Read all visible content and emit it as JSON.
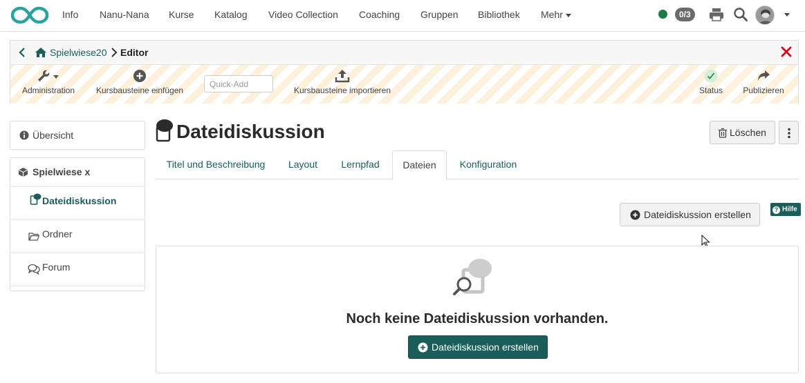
{
  "nav": {
    "items": [
      "Info",
      "Nanu-Nana",
      "Kurse",
      "Katalog",
      "Video Collection",
      "Coaching",
      "Gruppen",
      "Bibliothek"
    ],
    "more_label": "Mehr",
    "score": "0/3",
    "status_color": "#1e7a4a"
  },
  "breadcrumb": {
    "course": "Spielwiese20",
    "current": "Editor"
  },
  "toolbar": {
    "administration": "Administration",
    "add_elements": "Kursbausteine einfügen",
    "quick_add_placeholder": "Quick-Add",
    "import_elements": "Kursbausteine importieren",
    "status": "Status",
    "publish": "Publizieren"
  },
  "sidebar": {
    "overview": "Übersicht",
    "course_root": "Spielwiese x",
    "items": [
      {
        "label": "Dateidiskussion",
        "icon": "file-discussion-icon",
        "active": true
      },
      {
        "label": "Ordner",
        "icon": "folder-icon",
        "active": false
      },
      {
        "label": "Forum",
        "icon": "forum-icon",
        "active": false
      }
    ]
  },
  "main": {
    "title": "Dateidiskussion",
    "delete_label": "Löschen",
    "tabs": [
      {
        "label": "Titel und Beschreibung",
        "active": false
      },
      {
        "label": "Layout",
        "active": false
      },
      {
        "label": "Lernpfad",
        "active": false
      },
      {
        "label": "Dateien",
        "active": true
      },
      {
        "label": "Konfiguration",
        "active": false
      }
    ],
    "create_label": "Dateidiskussion erstellen",
    "help_label": "Hilfe",
    "empty_text": "Noch keine Dateidiskussion vorhanden.",
    "primary_create_label": "Dateidiskussion erstellen"
  },
  "colors": {
    "accent": "#1a5e5c",
    "close_red": "#d9001b",
    "stripe": "#fdf1dc"
  }
}
